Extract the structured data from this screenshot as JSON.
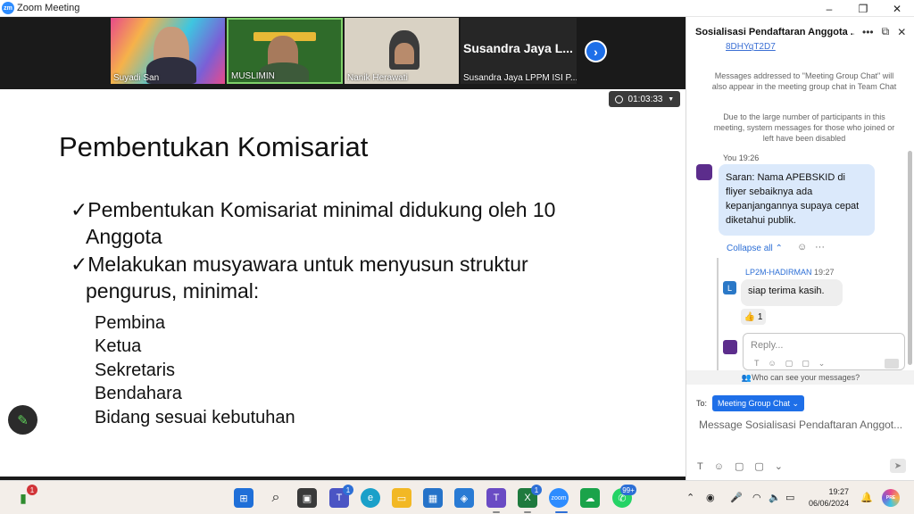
{
  "window": {
    "title": "Zoom Meeting",
    "logo": "zm",
    "controls": [
      "–",
      "❐",
      "✕"
    ]
  },
  "gallery": {
    "tiles": [
      {
        "name": "Suyadi San"
      },
      {
        "name": "MUSLIMIN"
      },
      {
        "name": "Nanik Herawati"
      },
      {
        "name": "Susandra Jaya LPPM ISI P...",
        "display": "Susandra Jaya L..."
      }
    ],
    "next_icon": "›"
  },
  "timer": {
    "value": "01:03:33"
  },
  "slide": {
    "title": "Pembentukan Komisariat",
    "bullets": [
      {
        "line1": "✓Pembentukan Komisariat minimal didukung oleh 10",
        "line2": "Anggota"
      },
      {
        "line1": "✓Melakukan musyawara untuk menyusun struktur",
        "line2": "pengurus, minimal:"
      }
    ],
    "roles": [
      "Pembina",
      "Ketua",
      "Sekretaris",
      "Bendahara",
      "Bidang sesuai kebutuhan"
    ],
    "pen_icon": "✎"
  },
  "chat": {
    "title": "Sosialisasi Pendaftaran Anggota ...",
    "partial_link": "8DHYqT2D7",
    "system_messages": [
      "Messages addressed to \"Meeting Group Chat\" will also appear in the meeting group chat in Team Chat",
      "Due to the large number of participants in this meeting, system messages for those who joined or left have been disabled"
    ],
    "you_label": "You",
    "you_time": "19:26",
    "you_message": "Saran: Nama APEBSKID di fliyer sebaiknya ada kepanjangannya supaya cepat diketahui publik.",
    "collapse_label": "Collapse all",
    "reply": {
      "sender": "LP2M-HADIRMAN",
      "time": "19:27",
      "avatar_letter": "L",
      "text": "siap terima kasih.",
      "reaction": "👍 1"
    },
    "reply_placeholder": "Reply...",
    "who_can_see": "Who can see your messages?",
    "to_label": "To:",
    "to_recipient": "Meeting Group Chat ⌄",
    "compose_placeholder": "Message Sosialisasi Pendaftaran Anggot..."
  },
  "taskbar": {
    "signal_badge": "1",
    "teams_badge": "1",
    "excel_badge": "1",
    "whatsapp_badge": "99+",
    "clock_time": "19:27",
    "clock_date": "06/06/2024",
    "pre_label": "PRE"
  }
}
